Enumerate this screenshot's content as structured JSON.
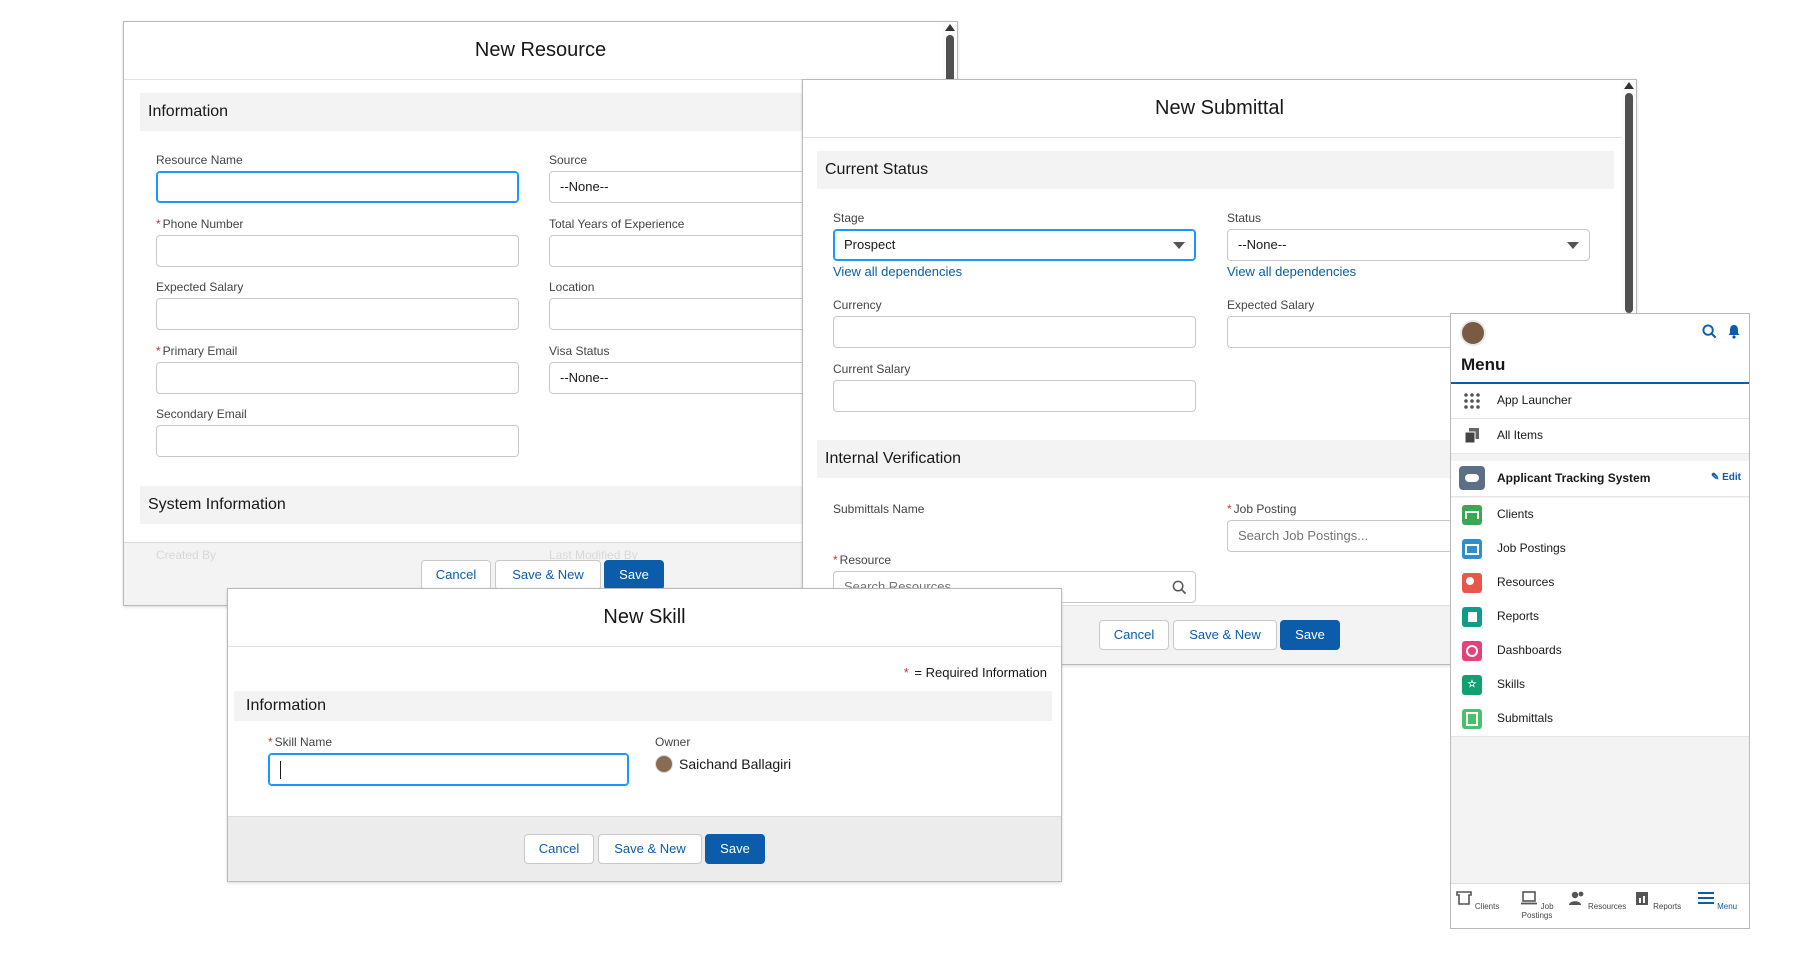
{
  "resource_form": {
    "title": "New Resource",
    "section_information": "Information",
    "section_system": "System Information",
    "resource_name_label": "Resource Name",
    "source_label": "Source",
    "source_value": "--None--",
    "phone_label": "Phone Number",
    "years_label": "Total Years of Experience",
    "expected_salary_label": "Expected Salary",
    "location_label": "Location",
    "primary_email_label": "Primary Email",
    "visa_label": "Visa Status",
    "visa_value": "--None--",
    "secondary_email_label": "Secondary Email",
    "created_by_label": "Created By",
    "last_modified_label": "Last Modified By",
    "cancel": "Cancel",
    "save_new": "Save & New",
    "save": "Save"
  },
  "submittal_form": {
    "title": "New Submittal",
    "section_status": "Current Status",
    "section_verification": "Internal Verification",
    "stage_label": "Stage",
    "stage_value": "Prospect",
    "status_label": "Status",
    "status_value": "--None--",
    "dependencies_link": "View all dependencies",
    "currency_label": "Currency",
    "expected_salary_label": "Expected Salary",
    "current_salary_label": "Current Salary",
    "submittals_name_label": "Submittals Name",
    "job_posting_label": "Job Posting",
    "job_posting_placeholder": "Search Job Postings...",
    "resource_label": "Resource",
    "resource_placeholder": "Search Resources...",
    "cancel": "Cancel",
    "save_new": "Save & New",
    "save": "Save"
  },
  "skill_form": {
    "title": "New Skill",
    "required_note": "= Required Information",
    "section_information": "Information",
    "skill_name_label": "Skill Name",
    "owner_label": "Owner",
    "owner_value": "Saichand Ballagiri",
    "cancel": "Cancel",
    "save_new": "Save & New",
    "save": "Save"
  },
  "mobile": {
    "title": "Menu",
    "items": [
      {
        "label": "App Launcher",
        "icon": "grid-icon"
      },
      {
        "label": "All Items",
        "icon": "stack-icon"
      }
    ],
    "app_name": "Applicant Tracking System",
    "edit_label": "Edit",
    "nav": [
      {
        "label": "Clients",
        "color": "#3ba755"
      },
      {
        "label": "Job Postings",
        "color": "#2e8fcf"
      },
      {
        "label": "Resources",
        "color": "#e8584a"
      },
      {
        "label": "Reports",
        "color": "#0f9d8a"
      },
      {
        "label": "Dashboards",
        "color": "#e2437a"
      },
      {
        "label": "Skills",
        "color": "#11a06f"
      },
      {
        "label": "Submittals",
        "color": "#4bbf6b"
      }
    ],
    "tabs": [
      {
        "label": "Clients"
      },
      {
        "label": "Job Postings"
      },
      {
        "label": "Resources"
      },
      {
        "label": "Reports"
      },
      {
        "label": "Menu"
      }
    ],
    "accent": "#0b5cab"
  }
}
